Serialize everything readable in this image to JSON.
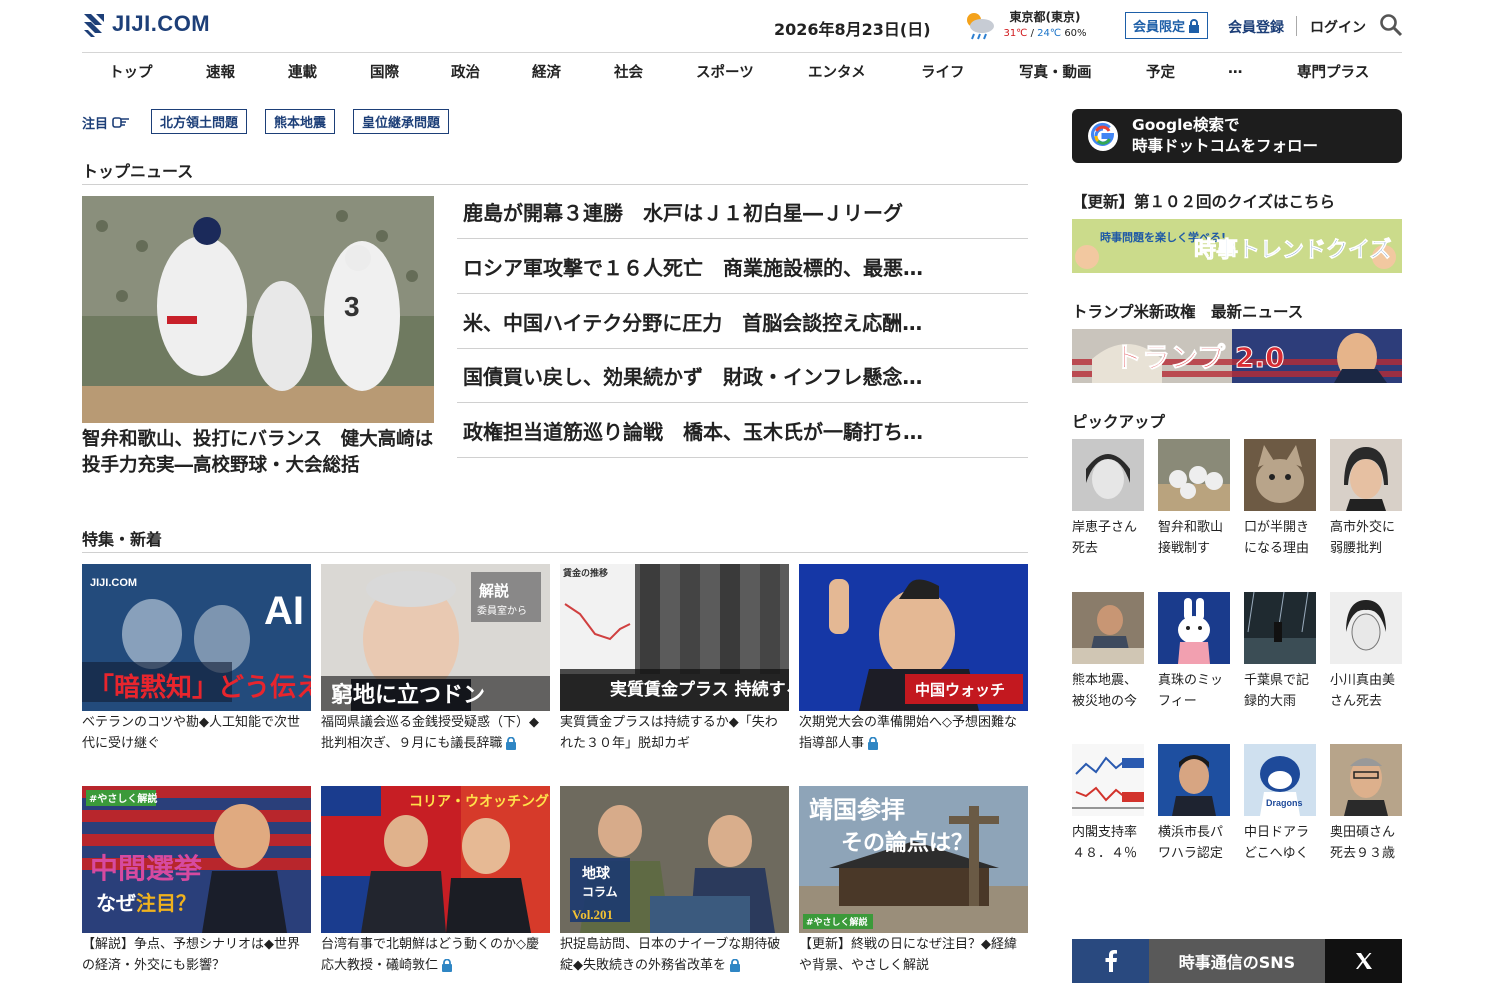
{
  "header": {
    "logo_text": "JIJI.COM",
    "date": "2026年8月23日(日)",
    "weather": {
      "city": "東京都(東京)",
      "high": "31℃",
      "low": "24℃",
      "rain": "60%"
    },
    "member_only": "会員限定",
    "register": "会員登録",
    "login": "ログイン"
  },
  "nav": [
    "トップ",
    "速報",
    "連載",
    "国際",
    "政治",
    "経済",
    "社会",
    "スポーツ",
    "エンタメ",
    "ライフ",
    "写真・動画",
    "予定",
    "…",
    "専門プラス"
  ],
  "attention": {
    "label": "注目",
    "tags": [
      "北方領土問題",
      "熊本地震",
      "皇位継承問題"
    ]
  },
  "top_news": {
    "title": "トップニュース",
    "hero_caption": "智弁和歌山、投打にバランス　健大高崎は投手力充実―高校野球・大会総括",
    "headlines": [
      "鹿島が開幕３連勝　水戸はＪ１初白星―Ｊリーグ",
      "ロシア軍攻撃で１６人死亡　商業施設標的、最悪…",
      "米、中国ハイテク分野に圧力　首脳会談控え応酬…",
      "国債買い戻し、効果続かず　財政・インフレ懸念…",
      "政権担当道筋巡り論戦　橋本、玉木氏が一騎打ち…"
    ]
  },
  "features": {
    "title": "特集・新着",
    "cards": [
      {
        "caption": "ベテランのコツや勘◆人工知能で次世代に受け継ぐ",
        "locked": false,
        "img_text": "「暗黙知」どう伝える",
        "img_corner": "AI"
      },
      {
        "caption": "福岡県議会巡る金銭授受疑惑（下）◆批判相次ぎ、９月にも議長辞職",
        "locked": true,
        "img_text": "窮地に立つドン",
        "img_corner": "解説 委員室から"
      },
      {
        "caption": "実質賃金プラスは持続するか◆「失われた３０年」脱却カギ",
        "locked": false,
        "img_text": "実質賃金プラス 持続する？",
        "img_corner": "賃金の推移"
      },
      {
        "caption": "次期党大会の準備開始へ◇予想困難な指導部人事",
        "locked": true,
        "img_text": "中国ウォッチ",
        "img_corner": ""
      },
      {
        "caption": "【解説】争点、予想シナリオは◆世界の経済・外交にも影響？",
        "locked": false,
        "img_text": "中間選挙 なぜ注目？",
        "img_corner": "#やさしく解説"
      },
      {
        "caption": "台湾有事で北朝鮮はどう動くのか◇慶応大教授・礒崎敦仁",
        "locked": true,
        "img_text": "コリア・ウオッチング",
        "img_corner": ""
      },
      {
        "caption": "択捉島訪問、日本のナイーブな期待破綻◆失敗続きの外務省改革を",
        "locked": true,
        "img_text": "地球コラム Vol.201",
        "img_corner": ""
      },
      {
        "caption": "【更新】終戦の日になぜ注目？◆経緯や背景、やさしく解説",
        "locked": false,
        "img_text": "靖国参拝 その論点は？",
        "img_corner": "#やさしく解説"
      }
    ]
  },
  "right": {
    "google_follow": [
      "Google検索で",
      "時事ドットコムをフォロー"
    ],
    "quiz_title": "【更新】第１０２回のクイズはこちら",
    "quiz_banner": {
      "left": "時事問題を楽しく学べる!",
      "main": "時事トレンドクイズ"
    },
    "trump_title": "トランプ米新政権　最新ニュース",
    "trump_banner": "トランプ 2.0",
    "pickup_title": "ピックアップ",
    "pickups": [
      "岸恵子さん死去",
      "智弁和歌山接戦制す",
      "口が半開きになる理由",
      "高市外交に弱腰批判",
      "熊本地震、被災地の今",
      "真珠のミッフィー",
      "千葉県で記録的大雨",
      "小川真由美さん死去",
      "内閣支持率４８．４％",
      "横浜市長パワハラ認定",
      "中日ドアラどこへゆく",
      "奥田碩さん死去９３歳"
    ],
    "sns_label": "時事通信のSNS"
  },
  "colors": {
    "brand": "#1d3f78",
    "accent_red": "#d0191c",
    "accent_blue": "#1a73c8"
  }
}
